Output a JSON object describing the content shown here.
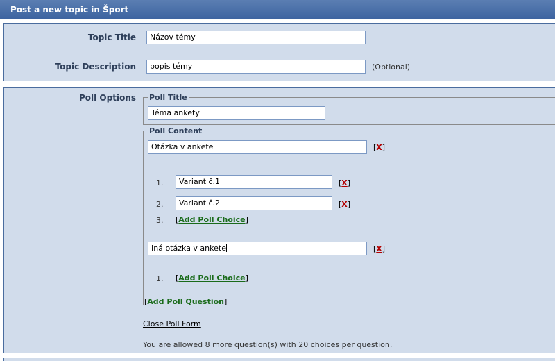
{
  "header": {
    "title": "Post a new topic in Šport"
  },
  "topic": {
    "title_label": "Topic Title",
    "title_value": "Názov témy",
    "description_label": "Topic Description",
    "description_value": "popis témy",
    "optional_note": "(Optional)"
  },
  "poll": {
    "options_label": "Poll Options",
    "title_legend": "Poll Title",
    "title_value": "Téma ankety",
    "content_legend": "Poll Content",
    "remove_left": "[",
    "remove_x": "X",
    "remove_right": "]",
    "questions": [
      {
        "value": "Otázka v ankete",
        "choices": [
          {
            "num": "1.",
            "value": "Variant č.1"
          },
          {
            "num": "2.",
            "value": "Variant č.2"
          }
        ],
        "add_num": "3."
      },
      {
        "value": "Iná otázka v ankete",
        "choices": [],
        "add_num": "1."
      }
    ],
    "add_choice_label": "Add Poll Choice",
    "add_question_label": "Add Poll Question",
    "close_label": "Close Poll Form",
    "allowance_text": "You are allowed 8 more question(s) with 20 choices per question."
  }
}
